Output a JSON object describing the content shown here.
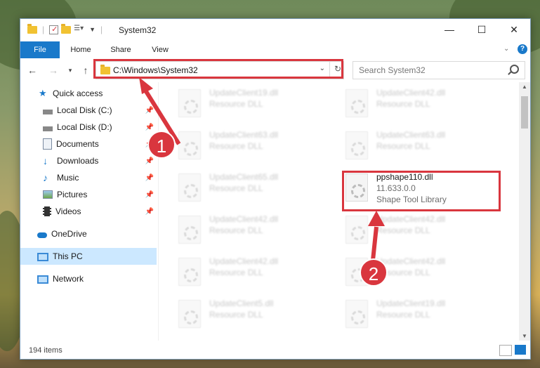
{
  "window": {
    "title": "System32",
    "controls": {
      "minimize": "—",
      "maximize": "☐",
      "close": "✕"
    }
  },
  "ribbon": {
    "tabs": [
      "File",
      "Home",
      "Share",
      "View"
    ],
    "help_icon": "question-icon"
  },
  "navigation": {
    "address": "C:\\Windows\\System32",
    "search_placeholder": "Search System32"
  },
  "sidebar": {
    "items": [
      {
        "label": "Quick access",
        "icon": "star-icon",
        "pinned": false
      },
      {
        "label": "Local Disk (C:)",
        "icon": "drive-icon",
        "pinned": true
      },
      {
        "label": "Local Disk (D:)",
        "icon": "drive-icon",
        "pinned": true
      },
      {
        "label": "Documents",
        "icon": "documents-icon",
        "pinned": true
      },
      {
        "label": "Downloads",
        "icon": "download-icon",
        "pinned": true
      },
      {
        "label": "Music",
        "icon": "music-icon",
        "pinned": true
      },
      {
        "label": "Pictures",
        "icon": "pictures-icon",
        "pinned": true
      },
      {
        "label": "Videos",
        "icon": "videos-icon",
        "pinned": true
      },
      {
        "label": "OneDrive",
        "icon": "cloud-icon",
        "pinned": false
      },
      {
        "label": "This PC",
        "icon": "computer-icon",
        "pinned": false,
        "selected": true
      },
      {
        "label": "Network",
        "icon": "network-icon",
        "pinned": false
      }
    ]
  },
  "files": [
    {
      "name": "UpdateClient19.dll",
      "type": "Resource DLL",
      "blurred": true
    },
    {
      "name": "UpdateClient42.dll",
      "type": "Resource DLL",
      "blurred": true
    },
    {
      "name": "UpdateClient63.dll",
      "type": "Resource DLL",
      "blurred": true
    },
    {
      "name": "UpdateClient63.dll",
      "type": "Resource DLL",
      "blurred": true
    },
    {
      "name": "UpdateClient65.dll",
      "type": "Resource DLL",
      "blurred": true
    },
    {
      "name": "ppshape110.dll",
      "version": "11.633.0.0",
      "type": "Shape Tool Library",
      "blurred": false,
      "highlighted": true
    },
    {
      "name": "UpdateClient42.dll",
      "type": "Resource DLL",
      "blurred": true
    },
    {
      "name": "UpdateClient42.dll",
      "type": "Resource DLL",
      "blurred": true
    },
    {
      "name": "UpdateClient42.dll",
      "type": "Resource DLL",
      "blurred": true
    },
    {
      "name": "UpdateClient42.dll",
      "type": "Resource DLL",
      "blurred": true
    },
    {
      "name": "UpdateClient5.dll",
      "type": "Resource DLL",
      "blurred": true
    },
    {
      "name": "UpdateClient19.dll",
      "type": "Resource DLL",
      "blurred": true
    }
  ],
  "status": {
    "item_count": "194 items"
  },
  "callouts": [
    "1",
    "2"
  ],
  "colors": {
    "accent": "#1979ca",
    "highlight": "#d9363e",
    "selected": "#cce8ff"
  }
}
